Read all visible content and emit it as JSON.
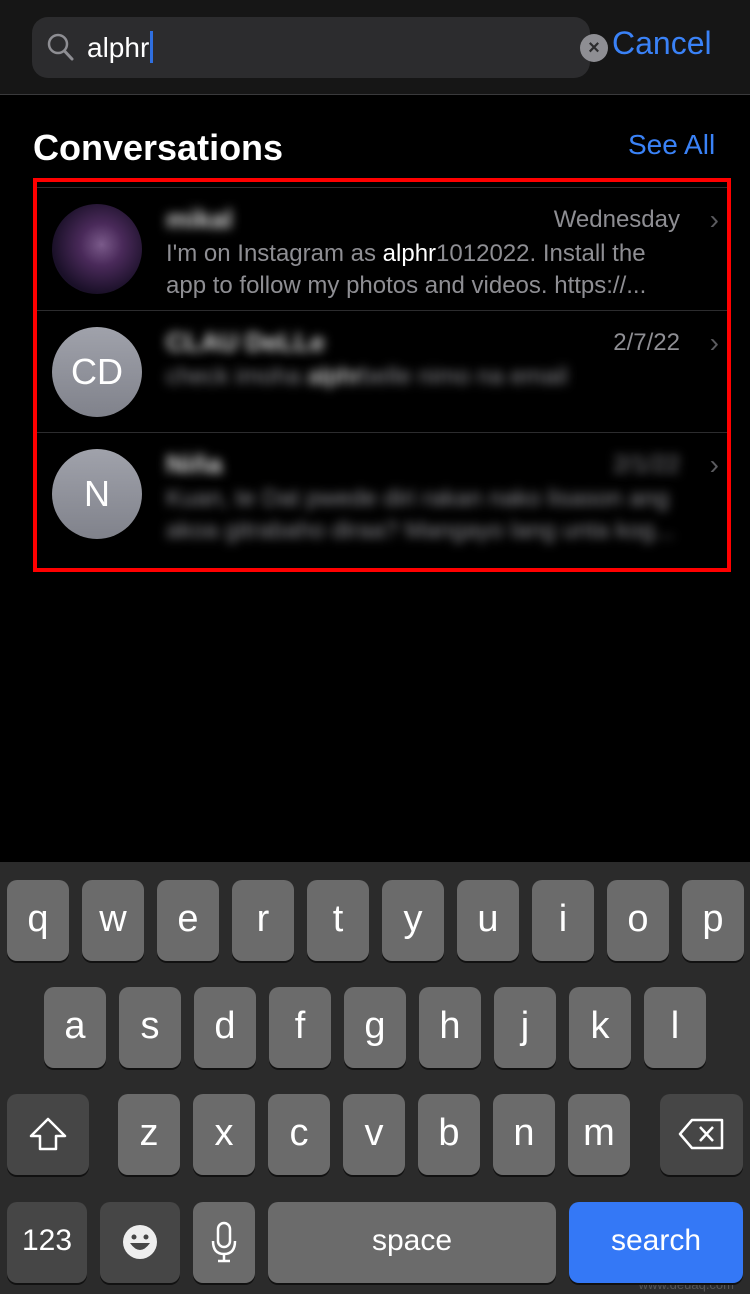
{
  "search": {
    "query": "alphr",
    "cancel_label": "Cancel"
  },
  "section": {
    "title": "Conversations",
    "see_all_label": "See All"
  },
  "colors": {
    "accent": "#3a82f7",
    "highlight_box": "#ff0000",
    "search_key": "#3478f6"
  },
  "conversations": [
    {
      "name": "mikal",
      "date": "Wednesday",
      "initials": "",
      "avatar": "photo",
      "message_before": "I'm on Instagram as ",
      "message_match": "alphr",
      "message_after": "1012022. Install the app to follow my photos and videos. https://...",
      "blurred_message": false,
      "blurred_date": false
    },
    {
      "name": "CLAU DeLLe",
      "date": "2/7/22",
      "initials": "CD",
      "avatar": "initials",
      "message_before": "check imoha ",
      "message_match": "alphr",
      "message_after": "belle nimo na email",
      "blurred_message": true,
      "blurred_date": false
    },
    {
      "name": "Niña",
      "date": "2/1/22",
      "initials": "N",
      "avatar": "initials",
      "message_before": "Kuan, te Dat pwede diri rakan nako lisason ang akoa gitrabaho diraa? Mangayo lang unta kog...",
      "message_match": "",
      "message_after": "",
      "blurred_message": true,
      "blurred_date": true
    }
  ],
  "keyboard": {
    "row1": [
      "q",
      "w",
      "e",
      "r",
      "t",
      "y",
      "u",
      "i",
      "o",
      "p"
    ],
    "row2": [
      "a",
      "s",
      "d",
      "f",
      "g",
      "h",
      "j",
      "k",
      "l"
    ],
    "row3": [
      "z",
      "x",
      "c",
      "v",
      "b",
      "n",
      "m"
    ],
    "numbers_label": "123",
    "space_label": "space",
    "search_label": "search",
    "icons": {
      "shift": "shift-icon",
      "delete": "delete-icon",
      "emoji": "emoji-icon",
      "mic": "microphone-icon"
    }
  },
  "watermark": "www.deuaq.com"
}
